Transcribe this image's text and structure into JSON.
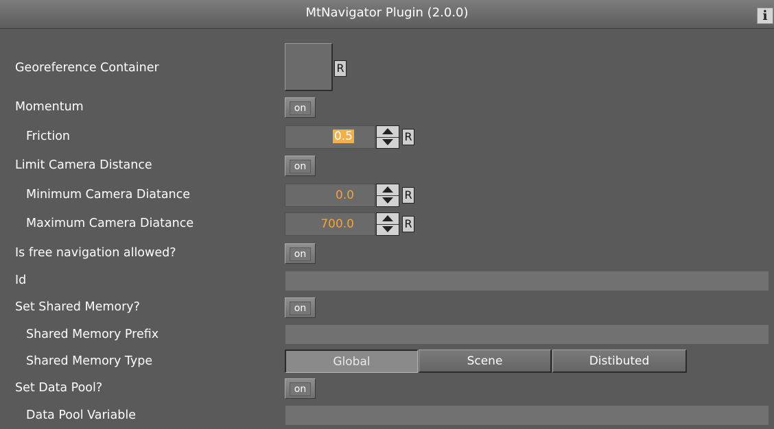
{
  "header": {
    "title": "MtNavigator Plugin (2.0.0)",
    "info_label": "i"
  },
  "labels": {
    "georeference_container": "Georeference Container",
    "momentum": "Momentum",
    "friction": "Friction",
    "limit_camera_distance": "Limit Camera Distance",
    "minimum_camera_distance": "Minimum Camera Diatance",
    "maximum_camera_distance": "Maximum Camera Diatance",
    "free_navigation": "Is free navigation allowed?",
    "id": "Id",
    "set_shared_memory": "Set Shared Memory?",
    "shared_memory_prefix": "Shared Memory Prefix",
    "shared_memory_type": "Shared Memory Type",
    "set_data_pool": "Set Data Pool?",
    "data_pool_variable": "Data Pool Variable"
  },
  "reset_label": "R",
  "toggles": {
    "momentum": "on",
    "limit_camera_distance": "on",
    "free_navigation": "on",
    "set_shared_memory": "on",
    "set_data_pool": "on"
  },
  "values": {
    "friction": "0.5",
    "minimum_camera_distance": "0.0",
    "maximum_camera_distance": "700.0",
    "id": "",
    "shared_memory_prefix": "",
    "data_pool_variable": ""
  },
  "shared_memory_type": {
    "options": [
      "Global",
      "Scene",
      "Distibuted"
    ],
    "selected": "Global"
  },
  "colors": {
    "panel_background": "#5a5a5a",
    "value_text": "#f3a33a",
    "selected_value_highlight": "#f3b04a"
  }
}
